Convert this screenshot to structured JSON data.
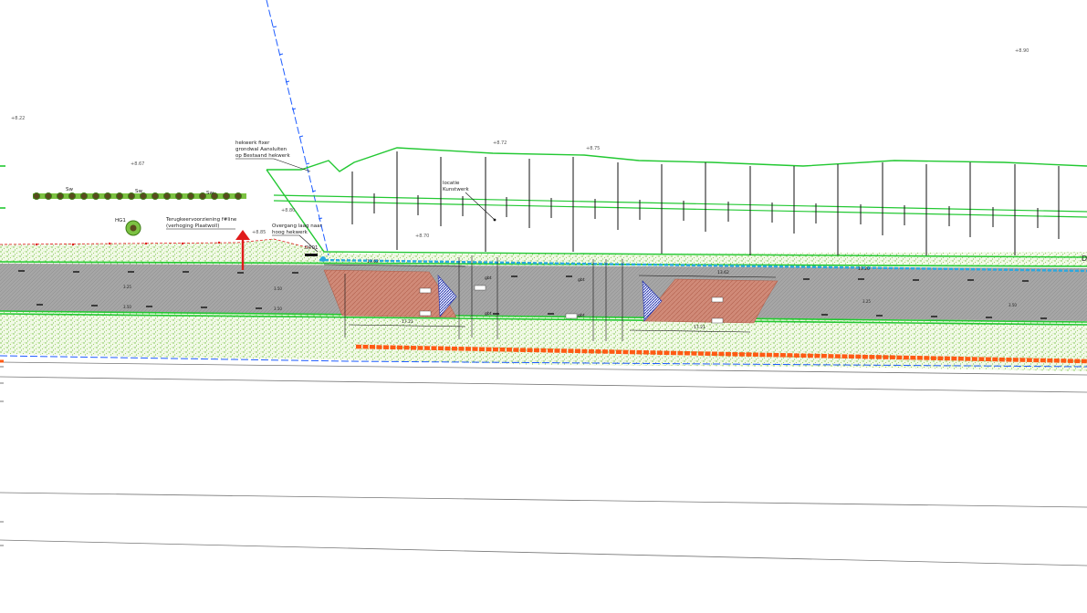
{
  "labels": {
    "hekwerk_1": "hekwerk fixer",
    "hekwerk_2": "grondwal Aansluiten",
    "hekwerk_3": "op Bestaand hekwerk",
    "terug_1": "Terugkeervoorziening f#line",
    "terug_2": "(verhoging Plaatwoll)",
    "overgang_1": "Overgang laag naar",
    "overgang_2": "hoog hekwerk",
    "locatie_1": "locatie",
    "locatie_2": "Kunstwerk",
    "dp": "DP01",
    "hg": "HG1",
    "sw": "Sw",
    "gbt": "gbt",
    "dim_1362": "13.62",
    "dim_1721": "17.21",
    "dim_1320": "13.20",
    "edge_d": "D"
  },
  "annotations": [
    "+8.22",
    "+8.67",
    "+8.72",
    "+8.75",
    "+8.80",
    "+8.70",
    "+8.90",
    "+8.85"
  ],
  "lane_marks": [
    "3.25",
    "3.50",
    "3.50",
    "3.50",
    "3.25",
    "3.50"
  ],
  "colors": {
    "vegetation": "#7cc242",
    "vegetation_alt": "#b5d98a",
    "asphalt": "#9a9a9a",
    "red_hatch": "#c8735f",
    "green_line": "#22c832",
    "blue_line": "#1e5cff",
    "light_blue": "#2aa8e0",
    "orange_line": "#ff5a14",
    "red_marker": "#e01b1b",
    "navy_hatch": "#2230a8"
  }
}
